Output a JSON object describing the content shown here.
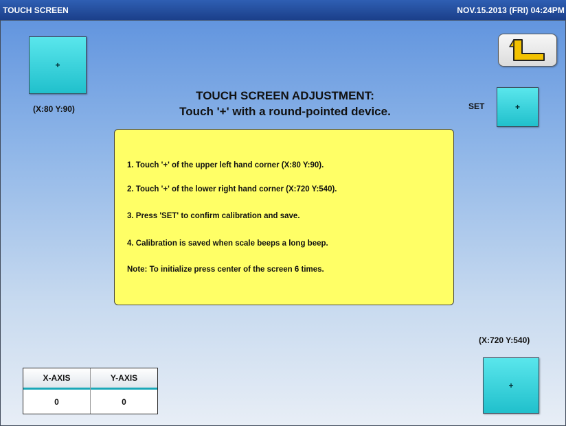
{
  "titlebar": {
    "title": "TOUCH SCREEN",
    "datetime": "NOV.15.2013 (FRI)  04:24PM"
  },
  "header": {
    "line1": "TOUCH SCREEN ADJUSTMENT:",
    "line2": "Touch '+' with a round-pointed device."
  },
  "targets": {
    "upper_left": {
      "label": "+",
      "coord": "(X:80 Y:90)"
    },
    "lower_right": {
      "label": "+",
      "coord": "(X:720 Y:540)"
    }
  },
  "set": {
    "label": "SET",
    "button_label": "+"
  },
  "back_button": {
    "icon": "return-arrow-icon"
  },
  "instructions": [
    "1. Touch '+' of the upper left hand corner (X:80 Y:90).",
    "2. Touch '+' of the lower right hand corner (X:720 Y:540).",
    "3. Press 'SET' to confirm calibration and save.",
    "4. Calibration is saved when scale beeps a long beep.",
    "Note: To initialize press center of the screen 6 times."
  ],
  "axis": {
    "x_label": "X-AXIS",
    "y_label": "Y-AXIS",
    "x_value": "0",
    "y_value": "0"
  },
  "colors": {
    "accent_cyan": "#20c0cc",
    "info_yellow": "#ffff66",
    "titlebar_blue": "#1b3f8a"
  }
}
